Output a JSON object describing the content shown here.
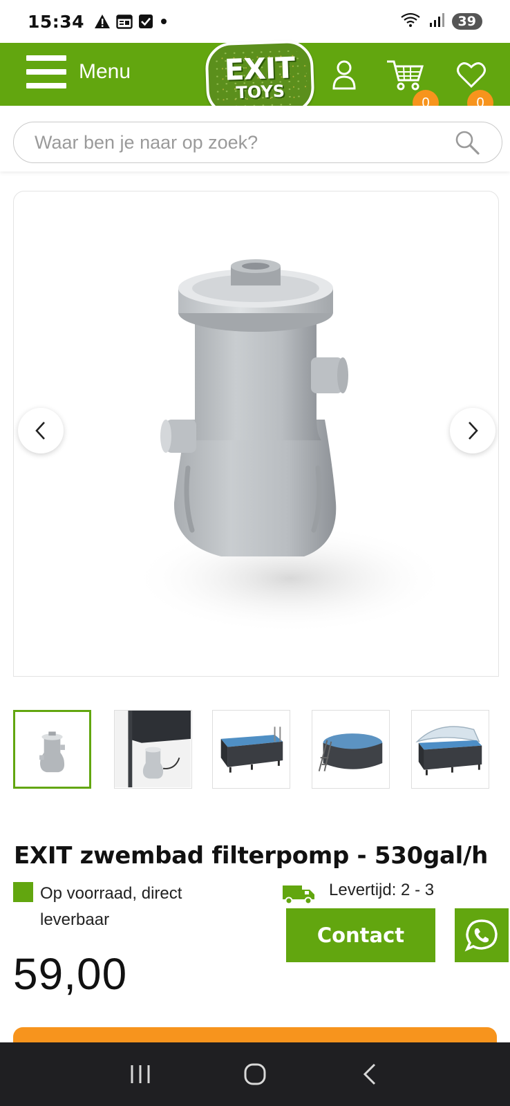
{
  "status_bar": {
    "time": "15:34",
    "battery": "39",
    "icons": [
      "warning-icon",
      "calendar-icon",
      "checkbox-icon",
      "dot-icon",
      "wifi-icon",
      "signal-icon"
    ]
  },
  "header": {
    "menu_label": "Menu",
    "logo_line1": "EXIT",
    "logo_line2": "TOYS",
    "cart_count": "0",
    "wishlist_count": "0",
    "brand_color": "#62a60f",
    "badge_color": "#f7941d"
  },
  "search": {
    "placeholder": "Waar ben je naar op zoek?",
    "value": ""
  },
  "gallery": {
    "thumbnails": [
      "filter-pump",
      "filter-pump-in-use",
      "rectangular-pool",
      "round-pool",
      "pool-with-cover"
    ],
    "active_index": 0
  },
  "product": {
    "title": "EXIT zwembad filterpomp - 530gal/h",
    "stock_text": "Op voorraad, direct leverbaar",
    "delivery_text": "Levertijd: 2 - 3",
    "contact_label": "Contact",
    "price": "59,00"
  }
}
